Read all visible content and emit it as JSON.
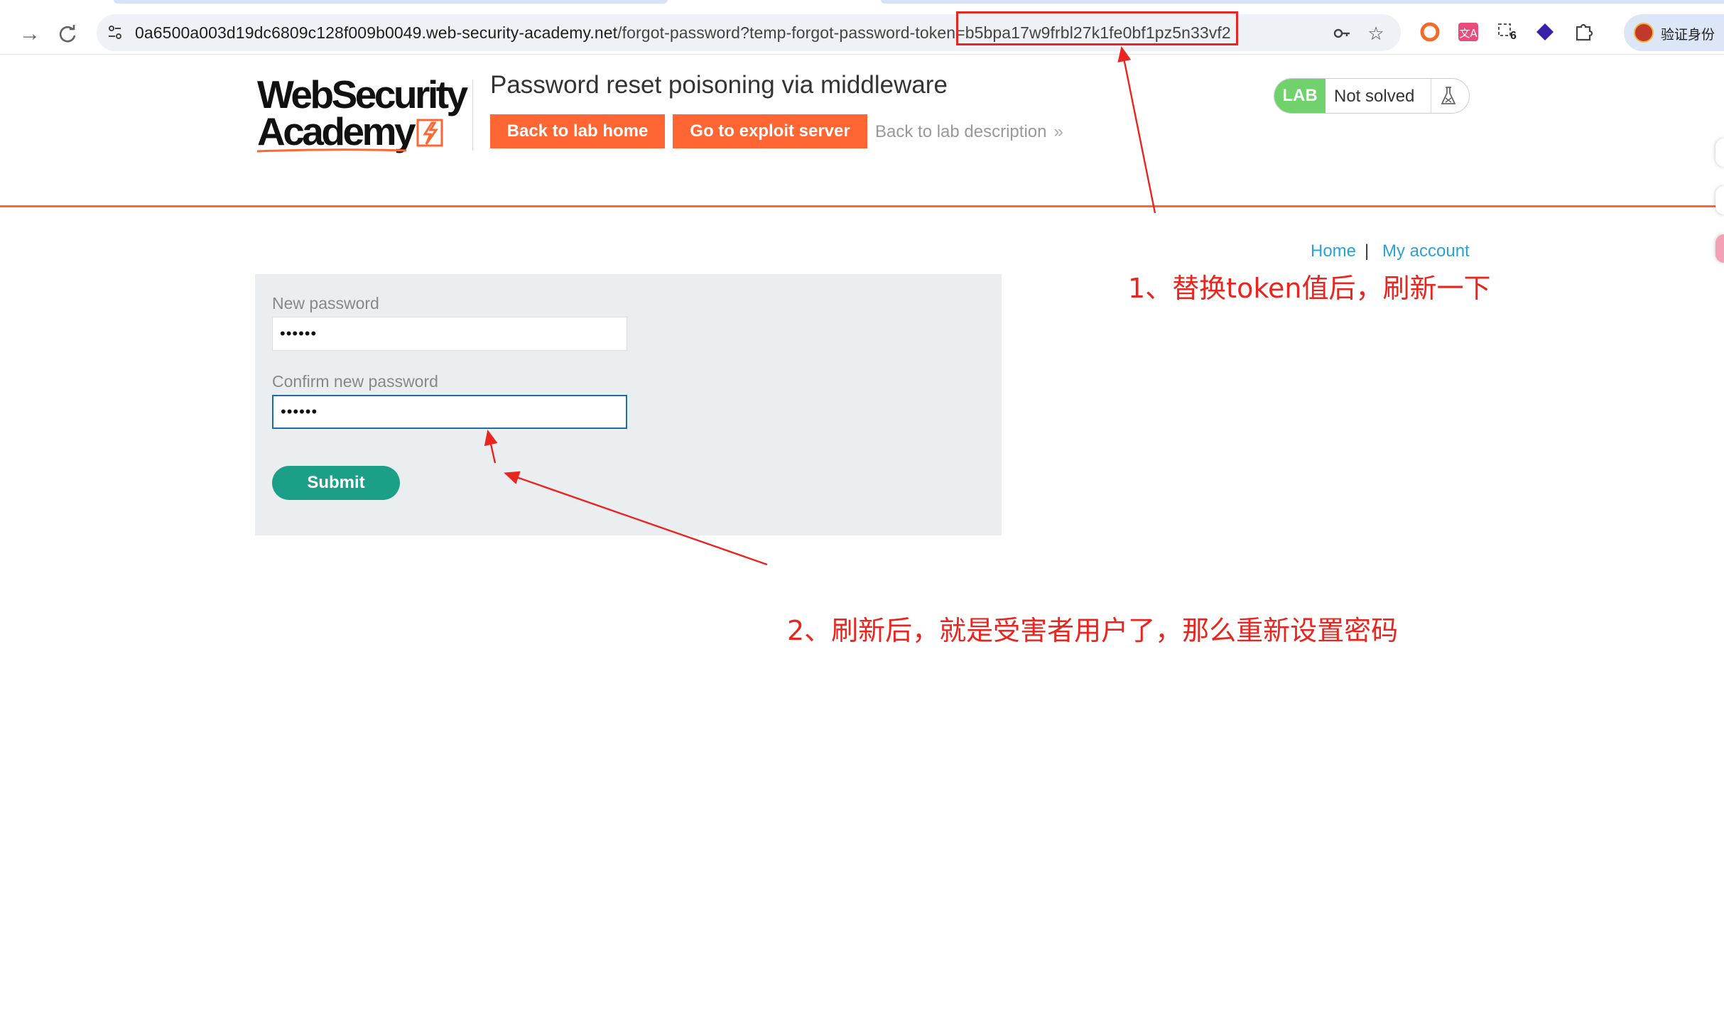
{
  "browser": {
    "url_host": "0a6500a003d19dc6809c128f009b0049.web-security-academy.net",
    "url_path": "/forgot-password?temp-forgot-password-token=b5bpa17w9frbl27k1fe0bf1pz5n33vf2",
    "extension_badge": "6",
    "profile_label": "验证身份",
    "icons": {
      "forward": "arrow-forward-icon",
      "reload": "reload-icon",
      "site_info": "tune-icon",
      "key": "key-icon",
      "star": "star-icon",
      "extensions": "puzzle-icon"
    }
  },
  "lab": {
    "logo_line1": "WebSecurity",
    "logo_line2": "Academy",
    "title": "Password reset poisoning via middleware",
    "back_home_label": "Back to lab home",
    "exploit_label": "Go to exploit server",
    "back_description_label": "Back to lab description",
    "status_tag": "LAB",
    "status_text": "Not solved"
  },
  "nav": {
    "home_label": "Home",
    "separator": "|",
    "account_label": "My account"
  },
  "form": {
    "new_password_label": "New password",
    "new_password_value": "••••••",
    "confirm_password_label": "Confirm new password",
    "confirm_password_value": "••••••",
    "submit_label": "Submit"
  },
  "annotations": {
    "note1": "1、替换token值后，刷新一下",
    "note2": "2、刷新后，就是受害者用户了，那么重新设置密码"
  },
  "colors": {
    "accent_orange": "#ff6633",
    "submit_green": "#1c9f87",
    "lab_green": "#70d16d",
    "link_blue": "#29a2dc",
    "annotation_red": "#e8251f"
  }
}
